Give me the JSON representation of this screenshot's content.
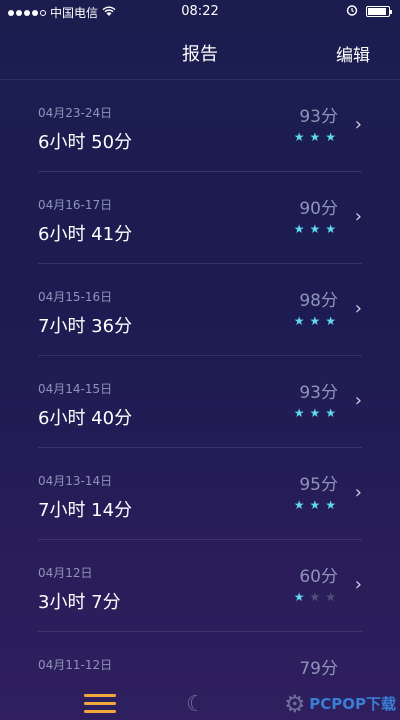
{
  "status_bar": {
    "carrier": "中国电信",
    "time": "08:22"
  },
  "nav": {
    "title": "报告",
    "edit_label": "编辑"
  },
  "reports": [
    {
      "date": "04月23-24日",
      "duration": "6小时 50分",
      "score": "93分",
      "stars": 3
    },
    {
      "date": "04月16-17日",
      "duration": "6小时 41分",
      "score": "90分",
      "stars": 3
    },
    {
      "date": "04月15-16日",
      "duration": "7小时 36分",
      "score": "98分",
      "stars": 3
    },
    {
      "date": "04月14-15日",
      "duration": "6小时 40分",
      "score": "93分",
      "stars": 3
    },
    {
      "date": "04月13-14日",
      "duration": "7小时 14分",
      "score": "95分",
      "stars": 3
    },
    {
      "date": "04月12日",
      "duration": "3小时 7分",
      "score": "60分",
      "stars": 1
    },
    {
      "date": "04月11-12日",
      "duration": "",
      "score": "79分",
      "stars": 0
    }
  ],
  "tab_bar": {
    "icons": [
      "list-icon",
      "moon-icon",
      "gear-icon"
    ]
  },
  "watermark": "PCPOP下载",
  "colors": {
    "star_on": "#5fd8f0",
    "star_off": "#505377",
    "accent": "#f2a93b"
  }
}
